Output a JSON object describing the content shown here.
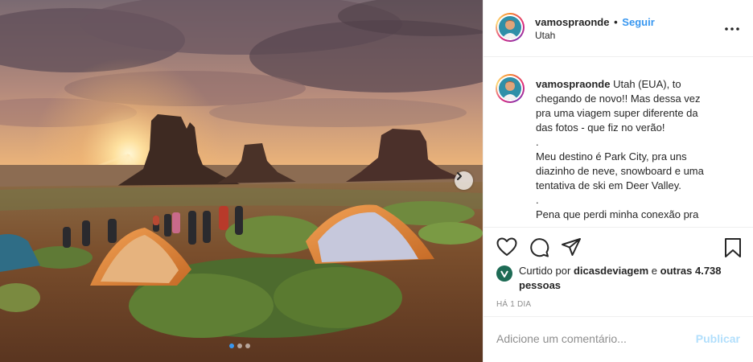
{
  "post": {
    "author": "vamospraonde",
    "separator": "•",
    "follow_label": "Seguir",
    "location": "Utah",
    "more_icon": "more-horizontal-icon"
  },
  "caption": {
    "author": "vamospraonde",
    "lines": [
      "Utah (EUA), to",
      "chegando de novo!! Mas dessa vez",
      "pra uma viagem super diferente da",
      "das fotos - que fiz no verão!",
      ".",
      "Meu destino é Park City, pra uns",
      "diazinho de neve, snowboard e uma",
      "tentativa de ski em Deer Valley.",
      ".",
      "Pena que perdi minha conexão pra"
    ]
  },
  "actions": {
    "like_icon": "heart-icon",
    "comment_icon": "comment-icon",
    "share_icon": "send-icon",
    "save_icon": "bookmark-icon"
  },
  "likes": {
    "prefix": "Curtido por",
    "user": "dicasdeviagem",
    "conjunction": "e",
    "others": "outras 4.738 pessoas"
  },
  "timestamp": "HÁ 1 DIA",
  "comment": {
    "placeholder": "Adicione um comentário...",
    "publish_label": "Publicar"
  },
  "carousel": {
    "total": 3,
    "active": 1
  },
  "colors": {
    "link": "#3897f0",
    "publish_disabled": "#b2dffc",
    "muted": "#8e8e8e"
  }
}
